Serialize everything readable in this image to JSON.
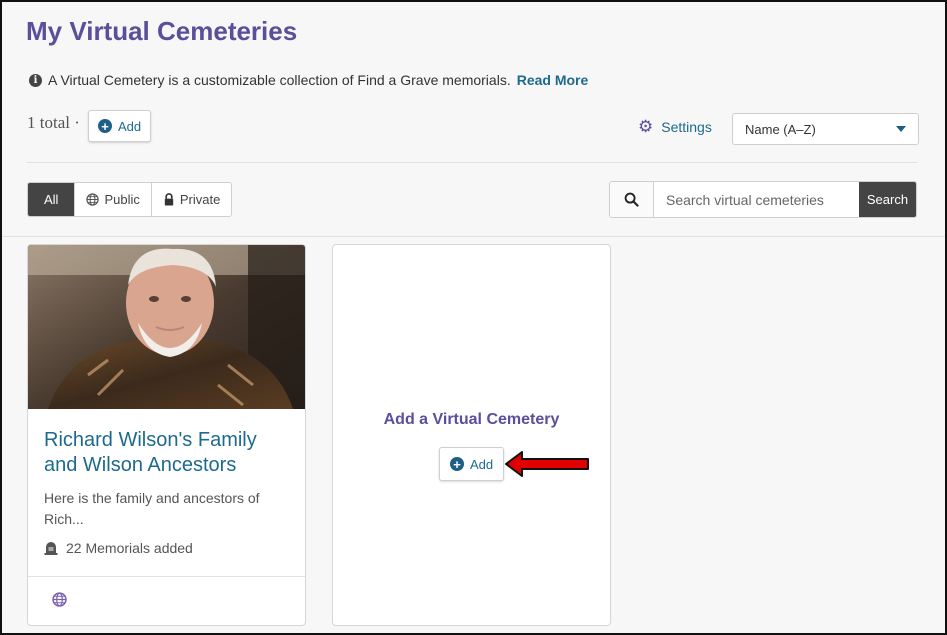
{
  "page": {
    "title": "My Virtual Cemeteries",
    "info_text": "A Virtual Cemetery is a customizable collection of Find a Grave memorials.",
    "read_more": "Read More"
  },
  "toolbar": {
    "total": "1 total ·",
    "add_label": "Add",
    "settings_label": "Settings",
    "sort_selected": "Name (A–Z)"
  },
  "filters": {
    "all": "All",
    "public": "Public",
    "private": "Private"
  },
  "search": {
    "placeholder": "Search virtual cemeteries",
    "button": "Search"
  },
  "cards": [
    {
      "title": "Richard Wilson's Family and Wilson Ancestors",
      "description": "Here is the family and ancestors of Rich...",
      "memorials": "22 Memorials added",
      "visibility_icon": "globe-icon"
    }
  ],
  "add_card": {
    "title": "Add a Virtual Cemetery",
    "button": "Add"
  },
  "colors": {
    "brand_purple": "#5b4e9b",
    "link_blue": "#1d6a8e",
    "dark_button": "#444444",
    "annotation_arrow": "#e00000"
  }
}
